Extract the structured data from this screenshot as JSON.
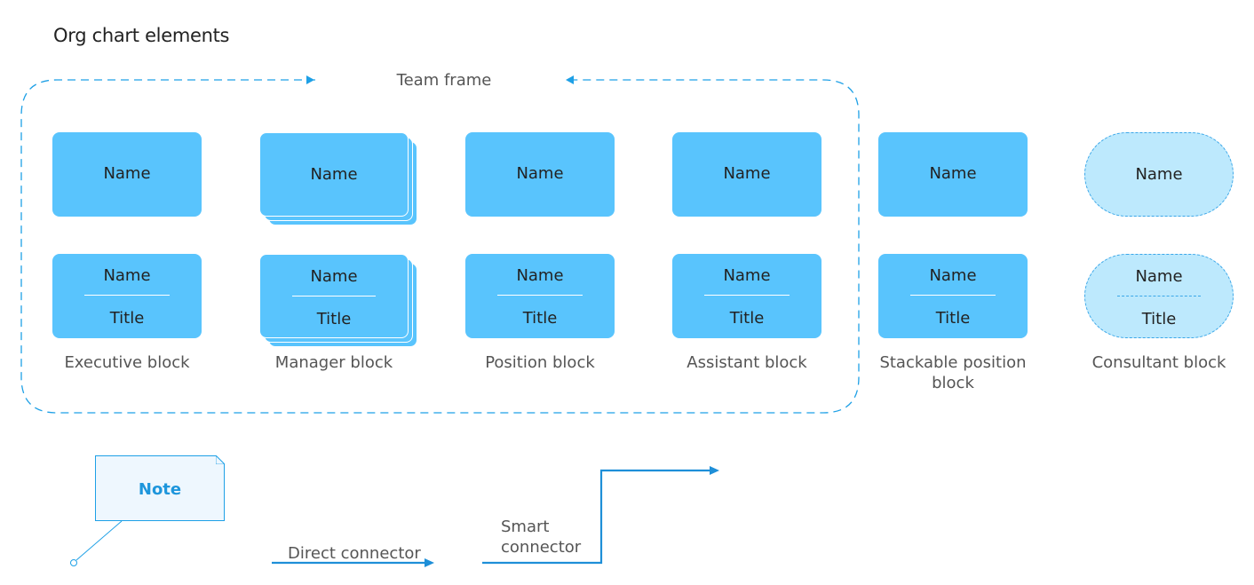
{
  "title": "Org chart elements",
  "team_frame": {
    "label": "Team frame"
  },
  "colors": {
    "block_fill": "#59c4fd",
    "consultant_fill": "#bde9fd",
    "accent": "#1e96dc",
    "text": "#222222",
    "caption": "#555555"
  },
  "blocks": [
    {
      "caption": "Executive block",
      "name": "Name",
      "title": "Title",
      "type": "executive"
    },
    {
      "caption": "Manager block",
      "name": "Name",
      "title": "Title",
      "type": "manager"
    },
    {
      "caption": "Position block",
      "name": "Name",
      "title": "Title",
      "type": "position"
    },
    {
      "caption": "Assistant block",
      "name": "Name",
      "title": "Title",
      "type": "assistant"
    },
    {
      "caption": "Stackable position block",
      "name": "Name",
      "title": "Title",
      "type": "stackable"
    },
    {
      "caption": "Consultant block",
      "name": "Name",
      "title": "Title",
      "type": "consultant"
    }
  ],
  "note": {
    "label": "Note"
  },
  "connectors": {
    "direct": "Direct connector",
    "smart": "Smart connector"
  }
}
